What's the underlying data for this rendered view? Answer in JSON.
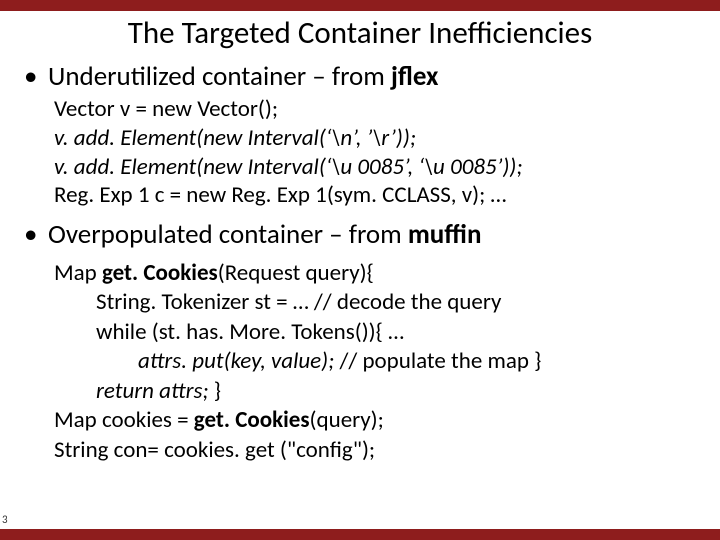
{
  "slide": {
    "title": "The Targeted Container Inefficiencies",
    "page_number": "3",
    "bullets": [
      {
        "prefix": "Underutilized container – from ",
        "em": "jflex",
        "code": [
          {
            "text": "Vector v = new Vector();",
            "italic": false
          },
          {
            "text": "v. add. Element(new Interval(‘\\n’, ’\\r’));",
            "italic": true
          },
          {
            "text": "v. add. Element(new Interval(‘\\u 0085’, ‘\\u 0085’));",
            "italic": true
          },
          {
            "text": "Reg. Exp 1 c = new Reg. Exp 1(sym. CCLASS, v); …",
            "italic": false
          }
        ]
      },
      {
        "prefix": "Overpopulated container – from ",
        "em": "muffin",
        "code2": {
          "l1a": "Map ",
          "l1b": "get. Cookies",
          "l1c": "(Request query){",
          "l2": "String. Tokenizer st =  … // decode the query",
          "l3": "while (st. has. More. Tokens()){ …",
          "l4a": "attrs. put(key, value); ",
          "l4b": "// populate the map }",
          "l5a": "return attrs;",
          "l5b": "  }",
          "l6a": "Map cookies = ",
          "l6b": "get. Cookies",
          "l6c": "(query);",
          "l7": "String con= cookies. get (\"config\");"
        }
      }
    ]
  }
}
